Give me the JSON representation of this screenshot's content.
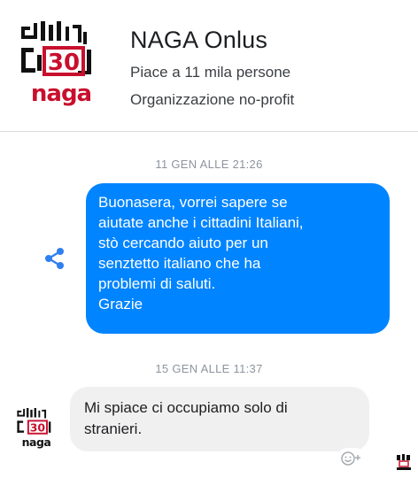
{
  "header": {
    "page_name": "NAGA Onlus",
    "likes": "Piace a 11 mila persone",
    "category": "Organizzazione no-profit",
    "logo_text": "30 naga",
    "logo_icon": "naga-logo-icon"
  },
  "conversation": {
    "timestamp_1": "11 GEN ALLE 21:26",
    "outgoing_message": {
      "lines": [
        "Buonasera, vorrei sapere se",
        "aiutate anche i cittadini Italiani,",
        "stò cercando aiuto per un",
        "senztetto italiano che ha",
        "problemi di saluti.",
        "Grazie"
      ]
    },
    "timestamp_2": "15 GEN ALLE 11:37",
    "incoming_message": {
      "lines": [
        "Mi spiace ci occupiamo solo di",
        "stranieri."
      ]
    }
  },
  "icons": {
    "share": "share-icon",
    "react": "add-reaction-icon",
    "seen": "seen-avatar-icon"
  },
  "colors": {
    "outgoing_bubble": "#0084ff",
    "incoming_bubble": "#f1f0f0",
    "logo_red": "#c8102e",
    "timestamp": "#8d949e"
  }
}
